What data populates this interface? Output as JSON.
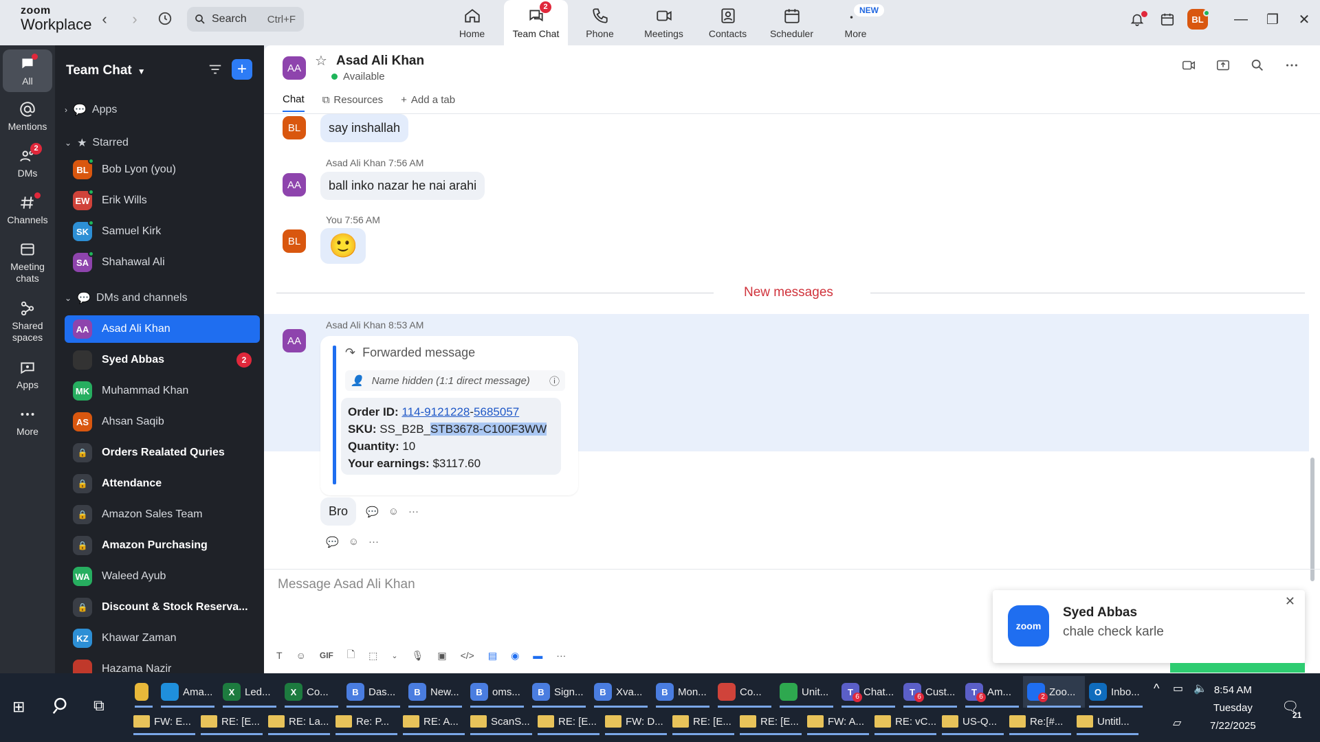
{
  "app": {
    "logo_line1": "zoom",
    "logo_line2": "Workplace"
  },
  "search": {
    "label": "Search",
    "shortcut": "Ctrl+F"
  },
  "topnav": [
    {
      "label": "Home",
      "icon": "home-icon"
    },
    {
      "label": "Team Chat",
      "icon": "chat-icon",
      "badge": "2",
      "active": true
    },
    {
      "label": "Phone",
      "icon": "phone-icon"
    },
    {
      "label": "Meetings",
      "icon": "video-icon"
    },
    {
      "label": "Contacts",
      "icon": "contacts-icon"
    },
    {
      "label": "Scheduler",
      "icon": "calendar-icon"
    },
    {
      "label": "More",
      "icon": "more-icon",
      "tag": "NEW"
    }
  ],
  "user": {
    "initials": "BL",
    "color": "#d9570f"
  },
  "rail": [
    {
      "label": "All"
    },
    {
      "label": "Mentions"
    },
    {
      "label": "DMs",
      "badge": "2"
    },
    {
      "label": "Channels"
    },
    {
      "label": "Meeting chats"
    },
    {
      "label": "Shared spaces"
    },
    {
      "label": "Apps"
    },
    {
      "label": "More"
    }
  ],
  "sidebar": {
    "title": "Team Chat",
    "apps_label": "Apps",
    "starred_label": "Starred",
    "dms_label": "DMs and channels",
    "starred": [
      {
        "initials": "BL",
        "name": "Bob Lyon (you)",
        "color": "#d9570f"
      },
      {
        "initials": "EW",
        "name": "Erik Wills",
        "color": "#d0433a"
      },
      {
        "initials": "SK",
        "name": "Samuel Kirk",
        "color": "#2d8fd5"
      },
      {
        "initials": "SA",
        "name": "Shahawal Ali",
        "color": "#8e44ad"
      }
    ],
    "dms": [
      {
        "initials": "AA",
        "name": "Asad Ali Khan",
        "color": "#8e44ad",
        "active": true
      },
      {
        "initials": "",
        "name": "Syed Abbas",
        "color": "#333",
        "bold": true,
        "count": "2"
      },
      {
        "initials": "MK",
        "name": "Muhammad Khan",
        "color": "#27ae60"
      },
      {
        "initials": "AS",
        "name": "Ahsan Saqib",
        "color": "#d9570f"
      },
      {
        "initials": "",
        "name": "Orders Realated Quries",
        "lock": true,
        "bold": true
      },
      {
        "initials": "",
        "name": "Attendance",
        "lock": true,
        "bold": true
      },
      {
        "initials": "",
        "name": "Amazon Sales Team",
        "lock": true
      },
      {
        "initials": "",
        "name": "Amazon Purchasing",
        "lock": true,
        "bold": true
      },
      {
        "initials": "WA",
        "name": "Waleed Ayub",
        "color": "#27ae60"
      },
      {
        "initials": "",
        "name": "Discount & Stock Reserva...",
        "lock": true,
        "bold": true
      },
      {
        "initials": "KZ",
        "name": "Khawar Zaman",
        "color": "#2d8fd5"
      },
      {
        "initials": "",
        "name": "Hazama Nazir",
        "color": "#c0392b"
      }
    ]
  },
  "chat": {
    "contact_initials": "AA",
    "contact_name": "Asad Ali Khan",
    "status": "Available",
    "tabs": [
      "Chat",
      "Resources",
      "Add a tab"
    ],
    "messages": [
      {
        "avatar": "BL",
        "text": "say inshallah"
      },
      {
        "avatar": "AA",
        "meta": "Asad Ali Khan 7:56 AM",
        "text": "ball inko nazar he nai arahi"
      },
      {
        "avatar": "BL",
        "meta": "You 7:56 AM",
        "text": "🙂"
      }
    ],
    "new_messages_label": "New messages",
    "forward": {
      "meta": "Asad Ali Khan 8:53 AM",
      "avatar": "AA",
      "header": "Forwarded message",
      "sub": "Name hidden (1:1 direct message)",
      "order_label": "Order ID:",
      "order_part1": "114-9121228",
      "order_dash": "-",
      "order_part2": "5685057",
      "sku_label": "SKU:",
      "sku_prefix": "SS_B2B_",
      "sku_selected": "STB3678-C100F3WW",
      "qty_label": "Quantity:",
      "qty_value": "10",
      "earn_label": "Your earnings:",
      "earn_value": "$3117.60"
    },
    "reply_text": "Bro",
    "composer_placeholder": "Message Asad Ali Khan"
  },
  "toast": {
    "app": "zoom",
    "name": "Syed Abbas",
    "message": "chale check karle"
  },
  "taskbar": {
    "apps": [
      {
        "label": "",
        "color": "#e8b83a"
      },
      {
        "label": "Ama...",
        "color": "#1f8fdc"
      },
      {
        "label": "Led...",
        "color": "#1d7b3f",
        "glyph": "X"
      },
      {
        "label": "Co...",
        "color": "#1d7b3f",
        "glyph": "X"
      },
      {
        "label": "Das...",
        "color": "#4a7de0",
        "glyph": "B"
      },
      {
        "label": "New...",
        "color": "#4a7de0",
        "glyph": "B"
      },
      {
        "label": "oms...",
        "color": "#4a7de0",
        "glyph": "B"
      },
      {
        "label": "Sign...",
        "color": "#4a7de0",
        "glyph": "B"
      },
      {
        "label": "Xva...",
        "color": "#4a7de0",
        "glyph": "B"
      },
      {
        "label": "Mon...",
        "color": "#4a7de0",
        "glyph": "B"
      },
      {
        "label": "Co...",
        "color": "#d0433a"
      },
      {
        "label": "Unit...",
        "color": "#2ea84f"
      },
      {
        "label": "Chat...",
        "color": "#5b5fc7",
        "glyph": "T",
        "badge": "6"
      },
      {
        "label": "Cust...",
        "color": "#5b5fc7",
        "glyph": "T",
        "badge": "6"
      },
      {
        "label": "Am...",
        "color": "#5b5fc7",
        "glyph": "T",
        "badge": "6"
      },
      {
        "label": "Zoo...",
        "color": "#1f6ef0",
        "badge": "2",
        "active": true
      },
      {
        "label": "Inbo...",
        "color": "#0f6cbd",
        "glyph": "O"
      }
    ],
    "mails": [
      "FW: E...",
      "RE: [E...",
      "RE: La...",
      "Re: P...",
      "RE: A...",
      "ScanS...",
      "RE: [E...",
      "FW: D...",
      "RE: [E...",
      "RE: [E...",
      "FW: A...",
      "RE: vC...",
      "US-Q...",
      "Re:[#...",
      "Untitl..."
    ],
    "time": "8:54 AM",
    "day": "Tuesday",
    "date": "7/22/2025",
    "notif_count": "21"
  }
}
